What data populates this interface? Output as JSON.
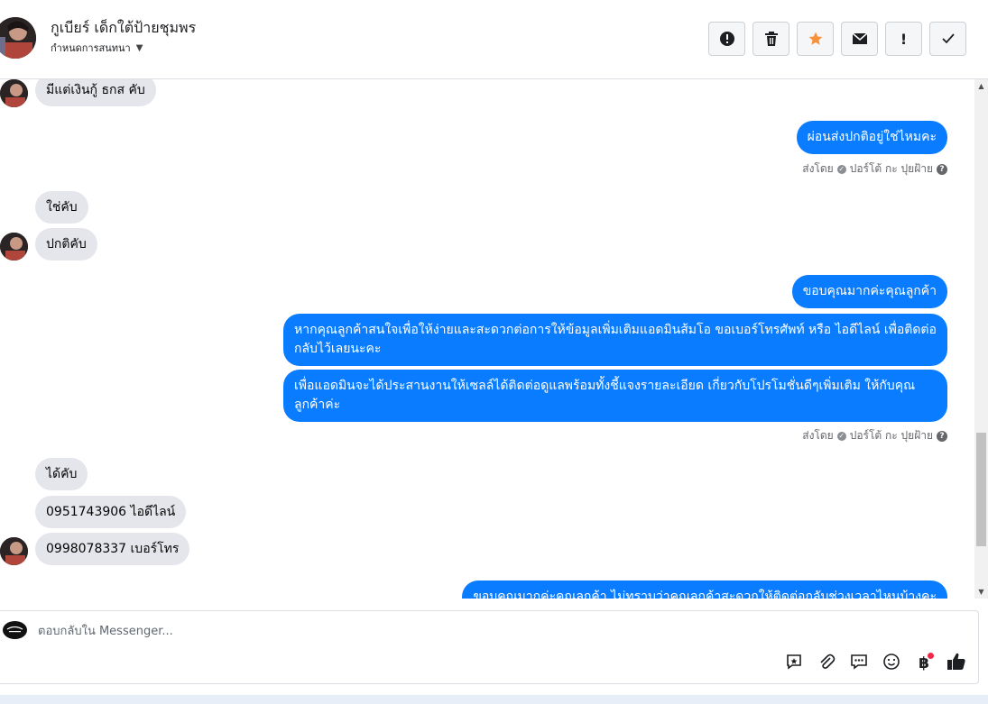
{
  "header": {
    "contact_name": "กูเบียร์ เด็กใต้ป้ายชุมพร",
    "conversation_settings": "กำหนดการสนทนา",
    "actions": [
      {
        "icon": "alert-circle-icon"
      },
      {
        "icon": "trash-icon"
      },
      {
        "icon": "star-icon"
      },
      {
        "icon": "envelope-icon"
      },
      {
        "icon": "exclamation-icon",
        "label": "!"
      },
      {
        "icon": "check-icon"
      }
    ],
    "star_color": "#f7923b"
  },
  "messages": {
    "m1": "มีแต่เงินกู้ ธกส คับ",
    "m2": "ผ่อนส่งปกติอยู่ใช่ไหมคะ",
    "meta1": "ส่งโดย",
    "meta1_sender": "ปอร์โต้ กะ ปุยฝ้าย",
    "m3": "ใช่คับ",
    "m4": "ปกติคับ",
    "m5": "ขอบคุณมากค่ะคุณลูกค้า",
    "m6": "หากคุณลูกค้าสนใจเพื่อให้ง่ายและสะดวกต่อการให้ข้อมูลเพิ่มเติมแอดมินส้มโอ ขอเบอร์โทรศัพท์ หรือ ไอดีไลน์ เพื่อติดต่อกลับไว้เลยนะคะ",
    "m7": "เพื่อแอดมินจะได้ประสานงานให้เซลล์ได้ติดต่อดูแลพร้อมทั้งชี้แจงรายละเอียด เกี่ยวกับโปรโมชั่นดีๆเพิ่มเติม ให้กับคุณลูกค้าค่ะ",
    "meta2": "ส่งโดย",
    "meta2_sender": "ปอร์โต้ กะ ปุยฝ้าย",
    "m8": "ได้คับ",
    "m9": "0951743906 ไอดีไลน์",
    "m10": "0998078337 เบอร์โทร",
    "m11": "ขอบคุณมากค่ะคุณลูกค้า ไม่ทราบว่าคุณลูกค้าสะดวกให้ติดต่อกลับช่วงเวลาไหนบ้างคะ"
  },
  "reply": {
    "placeholder": "ตอบกลับใน Messenger...",
    "tools": [
      "saved-reply-icon",
      "paperclip-icon",
      "chat-bubble-icon",
      "emoji-icon",
      "baht-icon",
      "thumbs-up-icon"
    ],
    "baht_label": "฿"
  },
  "colors": {
    "outgoing": "#0a7cff",
    "incoming": "#e4e6eb"
  }
}
